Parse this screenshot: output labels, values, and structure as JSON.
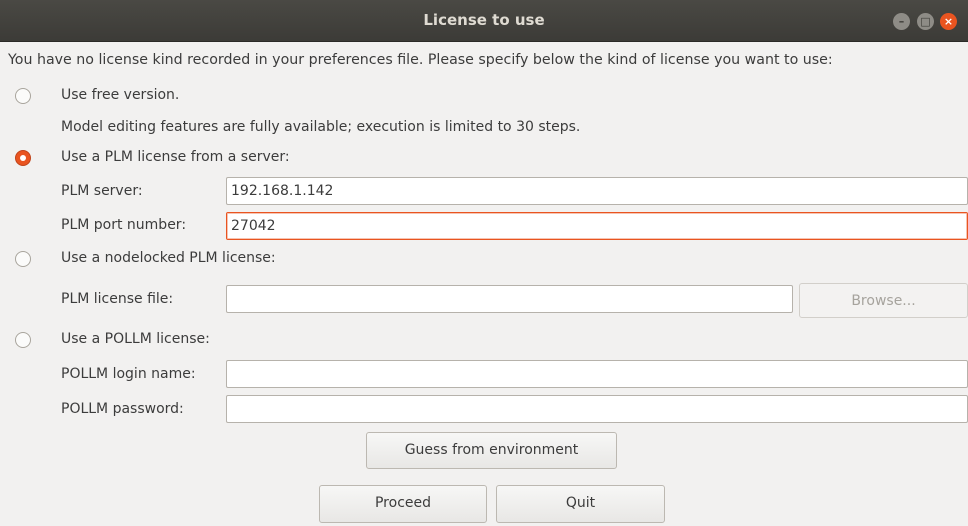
{
  "window": {
    "title": "License to use",
    "controls": {
      "minimize_icon": "minimize-icon",
      "maximize_icon": "maximize-icon",
      "close_icon": "close-icon"
    }
  },
  "intro_text": "You have no license kind recorded in your preferences file. Please specify below the kind of license you want to use:",
  "options": {
    "free": {
      "label": "Use free version.",
      "note": "Model editing features are fully available; execution is limited to 30 steps.",
      "selected": false
    },
    "server": {
      "label": "Use a PLM license from a server:",
      "selected": true,
      "server_label": "PLM server:",
      "server_value": "192.168.1.142",
      "port_label": "PLM port number:",
      "port_value": "27042"
    },
    "nodelocked": {
      "label": "Use a nodelocked PLM license:",
      "selected": false,
      "file_label": "PLM license file:",
      "file_value": "",
      "browse_label": "Browse..."
    },
    "pollm": {
      "label": "Use a POLLM license:",
      "selected": false,
      "login_label": "POLLM login name:",
      "login_value": "",
      "password_label": "POLLM password:",
      "password_value": ""
    }
  },
  "buttons": {
    "guess": "Guess from environment",
    "proceed": "Proceed",
    "quit": "Quit"
  },
  "colors": {
    "accent": "#e95420",
    "titlebar": "#3c3b37",
    "background": "#f2f1f0"
  }
}
